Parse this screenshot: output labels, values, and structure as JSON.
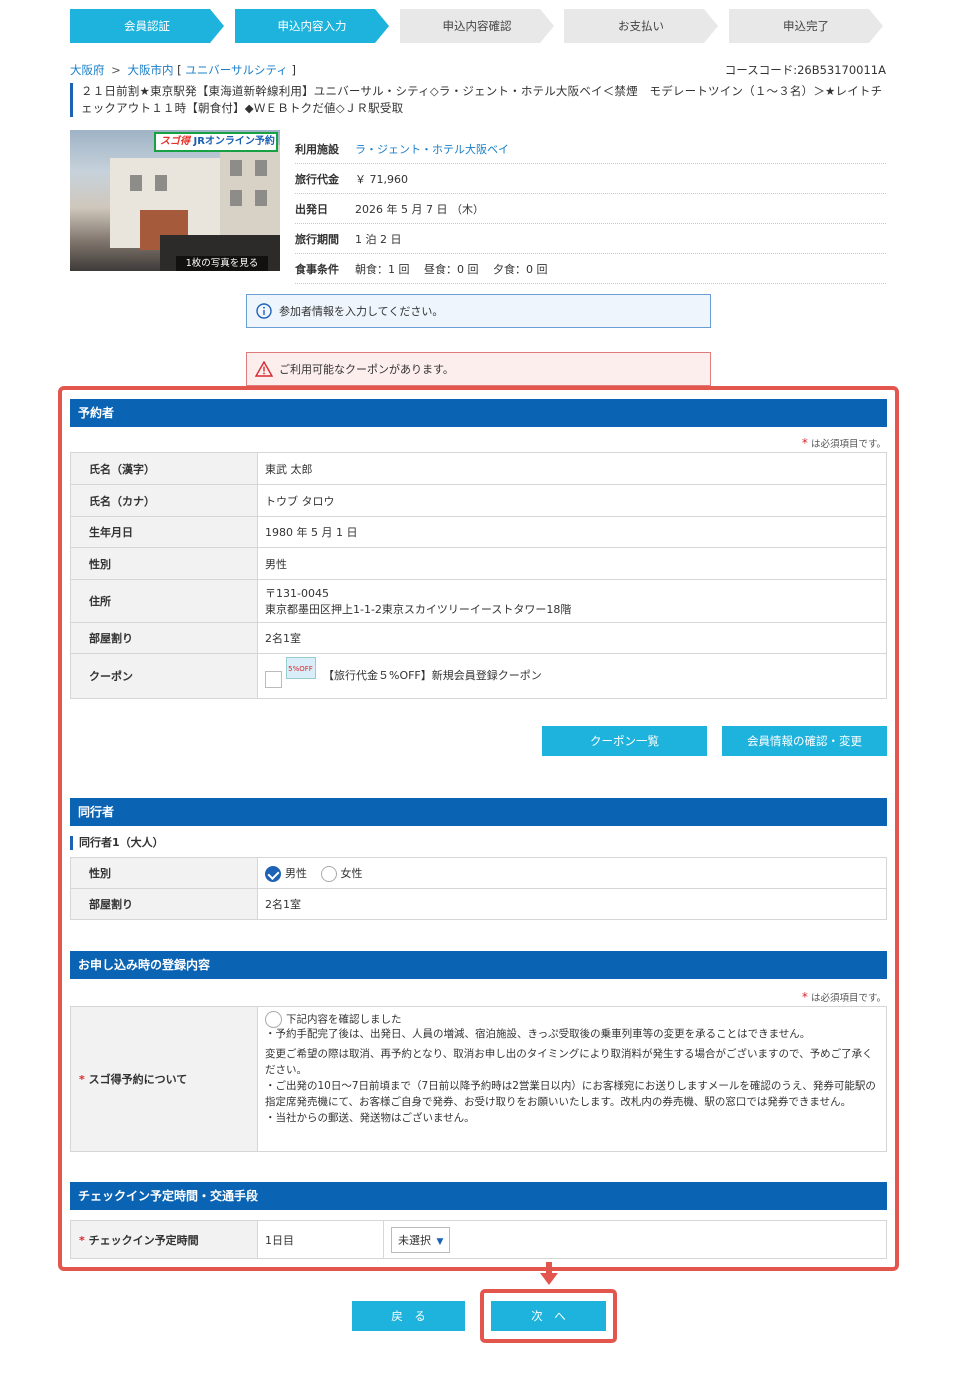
{
  "steps": [
    {
      "label": "会員認証",
      "state": "active"
    },
    {
      "label": "申込内容入力",
      "state": "active"
    },
    {
      "label": "申込内容確認",
      "state": "inactive"
    },
    {
      "label": "お支払い",
      "state": "inactive"
    },
    {
      "label": "申込完了",
      "state": "inactive"
    }
  ],
  "breadcrumb": {
    "pref": "大阪府",
    "sep1": ">",
    "city": "大阪市内",
    "area_open": "[",
    "area": "ユニバーサルシティ",
    "area_close": "]"
  },
  "course_code": "コースコード:26B53170011A",
  "plan_title": "２１日前割★東京駅発【東海道新幹線利用】ユニバーサル・シティ◇ラ・ジェント・ホテル大阪ベイ＜禁煙　モデレートツイン（１～３名）＞★レイトチェックアウト１１時【朝食付】◆ＷＥＢトクだ値◇ＪＲ駅受取",
  "photo": {
    "badge_sugo": "スゴ得",
    "badge_text": "JRオンライン予約",
    "count_label": "1枚の写真を見る"
  },
  "tour_info": {
    "facility_label": "利用施設",
    "facility": "ラ・ジェント・ホテル大阪ベイ",
    "price_label": "旅行代金",
    "price": "￥ 71,960",
    "depart_label": "出発日",
    "depart": "2026 年 5 月 7 日 （木）",
    "period_label": "旅行期間",
    "period": "1 泊 2 日",
    "meal_label": "食事条件",
    "meal": "朝食：1 回　 昼食：0 回　 夕食：0 回"
  },
  "notices": {
    "info": "参加者情報を入力してください。",
    "warn": "ご利用可能なクーポンがあります。"
  },
  "booker": {
    "heading": "予約者",
    "required_note": "は必須項目です。",
    "rows": {
      "kanji_label": "氏名（漢字）",
      "kanji": "東武 太郎",
      "kana_label": "氏名（カナ）",
      "kana": "トウブ タロウ",
      "birth_label": "生年月日",
      "birth": "1980 年 5 月 1 日",
      "gender_label": "性別",
      "gender": "男性",
      "address_label": "住所",
      "zip": "〒131-0045",
      "address": "東京都墨田区押上1-1-2東京スカイツリーイーストタワー18階",
      "room_label": "部屋割り",
      "room": "2名1室",
      "coupon_label": "クーポン",
      "coupon_thumb": "5%OFF",
      "coupon_text": "【旅行代金５%OFF】新規会員登録クーポン"
    },
    "btn_coupon_list": "クーポン一覧",
    "btn_member": "会員情報の確認・変更"
  },
  "companion": {
    "heading": "同行者",
    "sub_heading": "同行者1（大人）",
    "gender_label": "性別",
    "male": "男性",
    "female": "女性",
    "selected": "男性",
    "room_label": "部屋割り",
    "room": "2名1室"
  },
  "registration": {
    "heading": "お申し込み時の登録内容",
    "required_note": "は必須項目です。",
    "label": "スゴ得予約について",
    "check_label": "下記内容を確認しました",
    "p1": "・予約手配完了後は、出発日、人員の増減、宿泊施設、きっぷ受取後の乗車列車等の変更を承ることはできません。",
    "p2": "変更ご希望の際は取消、再予約となり、取消お申し出のタイミングにより取消料が発生する場合がございますので、予めご了承ください。",
    "p3": "・ご出発の10日～7日前頃まで（7日前以降予約時は2営業日以内）にお客様宛にお送りしますメールを確認のうえ、発券可能駅の指定席発売機にて、お客様ご自身で発券、お受け取りをお願いいたします。改札内の券売機、駅の窓口では発券できません。",
    "p4": "・当社からの郵送、発送物はございません。"
  },
  "checkin": {
    "heading": "チェックイン予定時間・交通手段",
    "label": "チェックイン予定時間",
    "day": "1日目",
    "select_value": "未選択"
  },
  "nav": {
    "back": "戻　る",
    "next": "次　へ"
  },
  "colors": {
    "accent": "#1eb3dd",
    "section_header": "#0b63b4",
    "highlight": "#e2564e",
    "required": "#d8282f"
  }
}
